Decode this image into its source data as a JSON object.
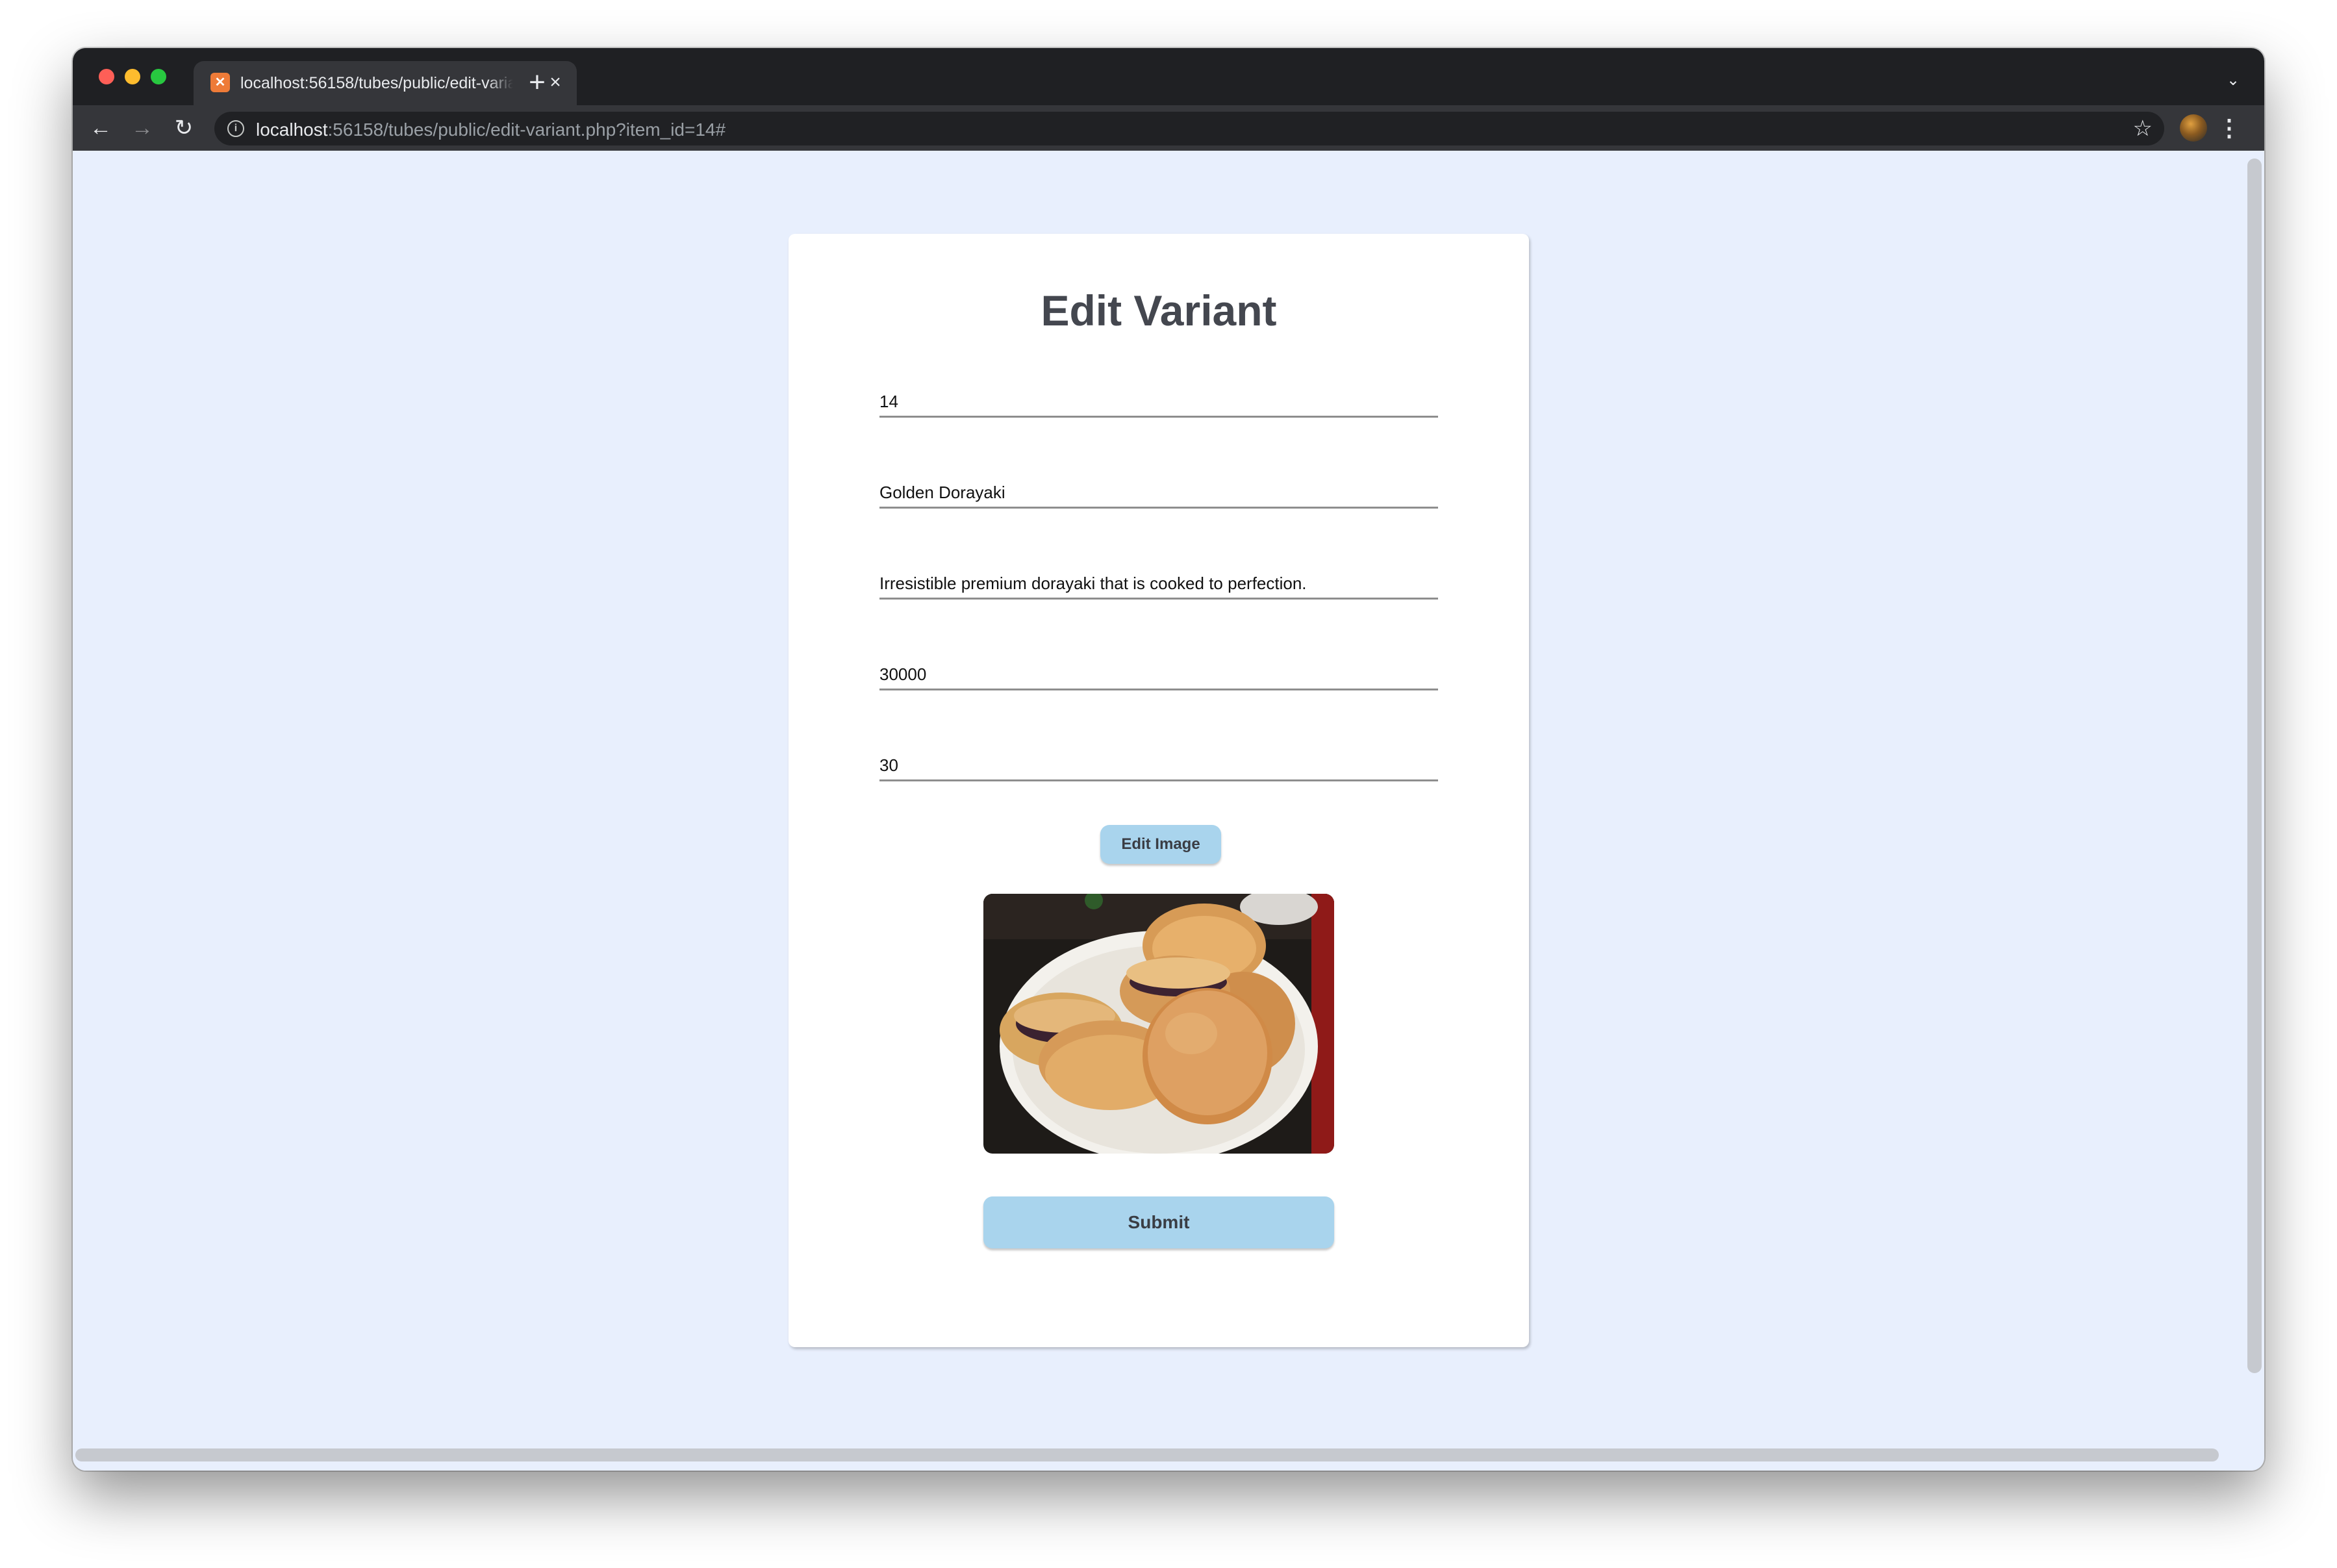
{
  "browser": {
    "tab_favicon": "xampp-favicon",
    "tab_title": "localhost:56158/tubes/public/edit-variant.php?item_id=14#",
    "tab_close_icon": "close-icon",
    "new_tab_icon": "plus-icon",
    "tab_search_icon": "chevron-down-icon",
    "back_icon": "arrow-left-icon",
    "forward_icon": "arrow-right-icon",
    "reload_icon": "reload-icon",
    "site_info_icon": "info-icon",
    "url_host": "localhost",
    "url_path": ":56158/tubes/public/edit-variant.php?item_id=14#",
    "bookmark_icon": "star-icon",
    "menu_icon": "kebab-menu-icon"
  },
  "page": {
    "title": "Edit Variant",
    "fields": {
      "id": "14",
      "name": "Golden Dorayaki",
      "description": "Irresistible premium dorayaki that is cooked to perfection.",
      "price": "30000",
      "stock": "30"
    },
    "edit_image_label": "Edit Image",
    "submit_label": "Submit",
    "colors": {
      "background": "#e8effd",
      "card": "#ffffff",
      "button": "#a9d4ed",
      "title": "#44474f"
    }
  }
}
